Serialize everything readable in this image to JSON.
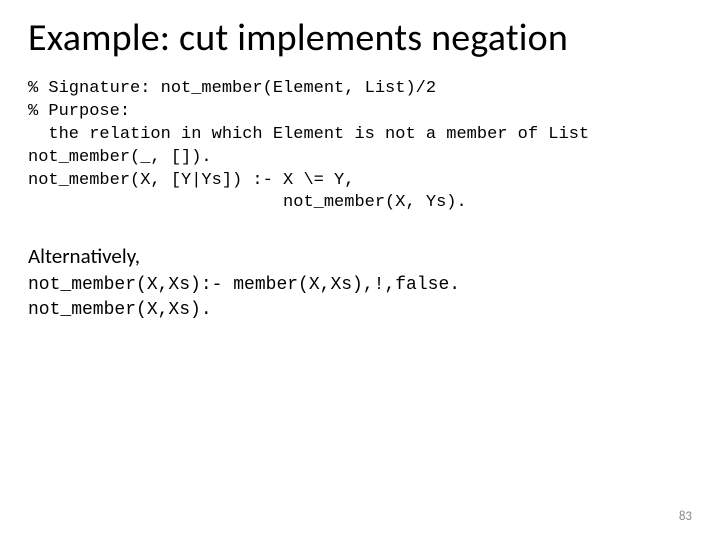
{
  "title": "Example: cut implements negation",
  "code_block_1": "% Signature: not_member(Element, List)/2\n% Purpose:\n  the relation in which Element is not a member of List\nnot_member(_, []).\nnot_member(X, [Y|Ys]) :- X \\= Y,\n                         not_member(X, Ys).",
  "alt_label": "Alternatively,",
  "code_block_2": "not_member(X,Xs):- member(X,Xs),!,false.\nnot_member(X,Xs).",
  "page_number": "83"
}
